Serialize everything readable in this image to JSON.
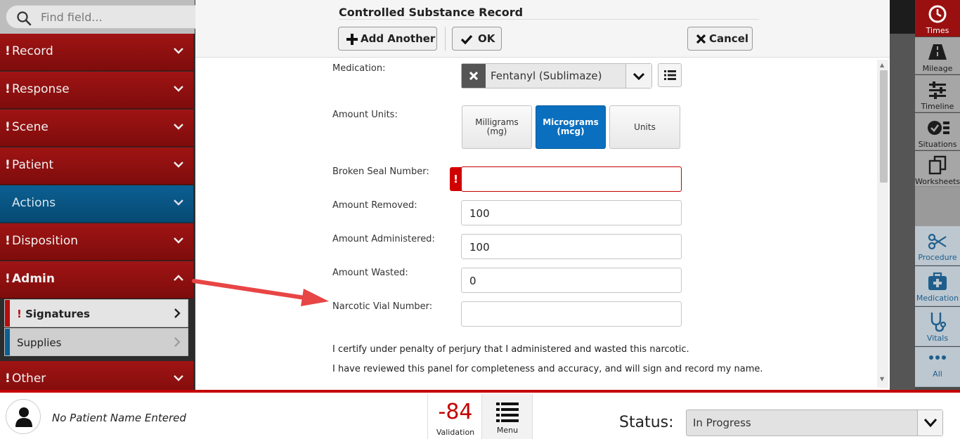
{
  "sidebar": {
    "search_placeholder": "Find field...",
    "items": [
      {
        "label": "Record",
        "flag": "!"
      },
      {
        "label": "Response",
        "flag": "!"
      },
      {
        "label": "Scene",
        "flag": "!"
      },
      {
        "label": "Patient",
        "flag": "!"
      },
      {
        "label": "Actions",
        "flag": ""
      },
      {
        "label": "Disposition",
        "flag": "!"
      },
      {
        "label": "Admin",
        "flag": "!"
      },
      {
        "label": "Other",
        "flag": "!"
      }
    ],
    "subitems": [
      {
        "label": "Signatures",
        "flag": "!"
      },
      {
        "label": "Supplies",
        "flag": ""
      }
    ]
  },
  "modal": {
    "title": "Controlled Substance Record",
    "add_another_label": "Add Another",
    "ok_label": "OK",
    "cancel_label": "Cancel",
    "medication_label": "Medication:",
    "medication_value": "Fentanyl (Sublimaze)",
    "amount_units_label": "Amount Units:",
    "units": [
      {
        "line1": "Milligrams",
        "line2": "(mg)",
        "selected": false
      },
      {
        "line1": "Micrograms",
        "line2": "(mcg)",
        "selected": true
      },
      {
        "line1": "Units",
        "line2": "",
        "selected": false
      }
    ],
    "broken_seal_label": "Broken Seal Number:",
    "broken_seal_value": "",
    "error_flag": "!",
    "amount_removed_label": "Amount Removed:",
    "amount_removed_value": "100",
    "amount_administered_label": "Amount Administered:",
    "amount_administered_value": "100",
    "amount_wasted_label": "Amount Wasted:",
    "amount_wasted_value": "0",
    "vial_number_label": "Narcotic Vial Number:",
    "vial_number_value": "",
    "certify_line1": "I certify under penalty of perjury that I administered and wasted this narcotic.",
    "certify_line2": "I have reviewed this panel for completeness and accuracy, and will sign and record my name."
  },
  "toolbar": {
    "items": [
      {
        "label": "Times",
        "icon": "clock-icon"
      },
      {
        "label": "Mileage",
        "icon": "road-icon"
      },
      {
        "label": "Timeline",
        "icon": "sliders-icon"
      },
      {
        "label": "Situations",
        "icon": "checklist-icon"
      },
      {
        "label": "Worksheets",
        "icon": "copy-icon"
      },
      {
        "label": "Procedure",
        "icon": "scissors-icon"
      },
      {
        "label": "Medication",
        "icon": "medkit-icon"
      },
      {
        "label": "Vitals",
        "icon": "stethoscope-icon"
      },
      {
        "label": "All",
        "icon": "ellipsis-icon"
      }
    ]
  },
  "bottom": {
    "patient_name": "No Patient Name Entered",
    "validation_count": "-84",
    "validation_label": "Validation",
    "menu_label": "Menu",
    "status_label": "Status:",
    "status_value": "In Progress"
  },
  "colors": {
    "section_red": "#8e1010",
    "section_blue": "#0b5f92",
    "selected_blue": "#0a6fbf",
    "error_red": "#d10000",
    "arrow_red": "#e84545"
  }
}
